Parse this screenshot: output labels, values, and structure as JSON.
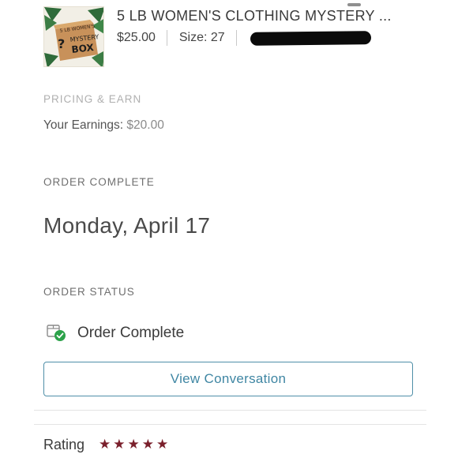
{
  "product": {
    "title": "5 LB WOMEN'S CLOTHING MYSTERY ...",
    "price": "$25.00",
    "size": "Size: 27",
    "image_text": [
      "5 LB WOMEN'S",
      "?",
      "MYSTERY",
      "BOX"
    ]
  },
  "pricing": {
    "label": "PRICING & EARN",
    "earnings_label": "Your Earnings:",
    "earnings_value": "$20.00"
  },
  "order": {
    "complete_label": "ORDER COMPLETE",
    "date": "Monday, April 17",
    "status_label": "ORDER STATUS",
    "status": "Order Complete",
    "status_icon": "package-check-icon"
  },
  "actions": {
    "view_conversation": "View Conversation"
  },
  "rating": {
    "label": "Rating",
    "stars": 5,
    "star_color": "#7a1f2b"
  },
  "colors": {
    "accent": "#4f8fa8",
    "success": "#2ca24a"
  }
}
